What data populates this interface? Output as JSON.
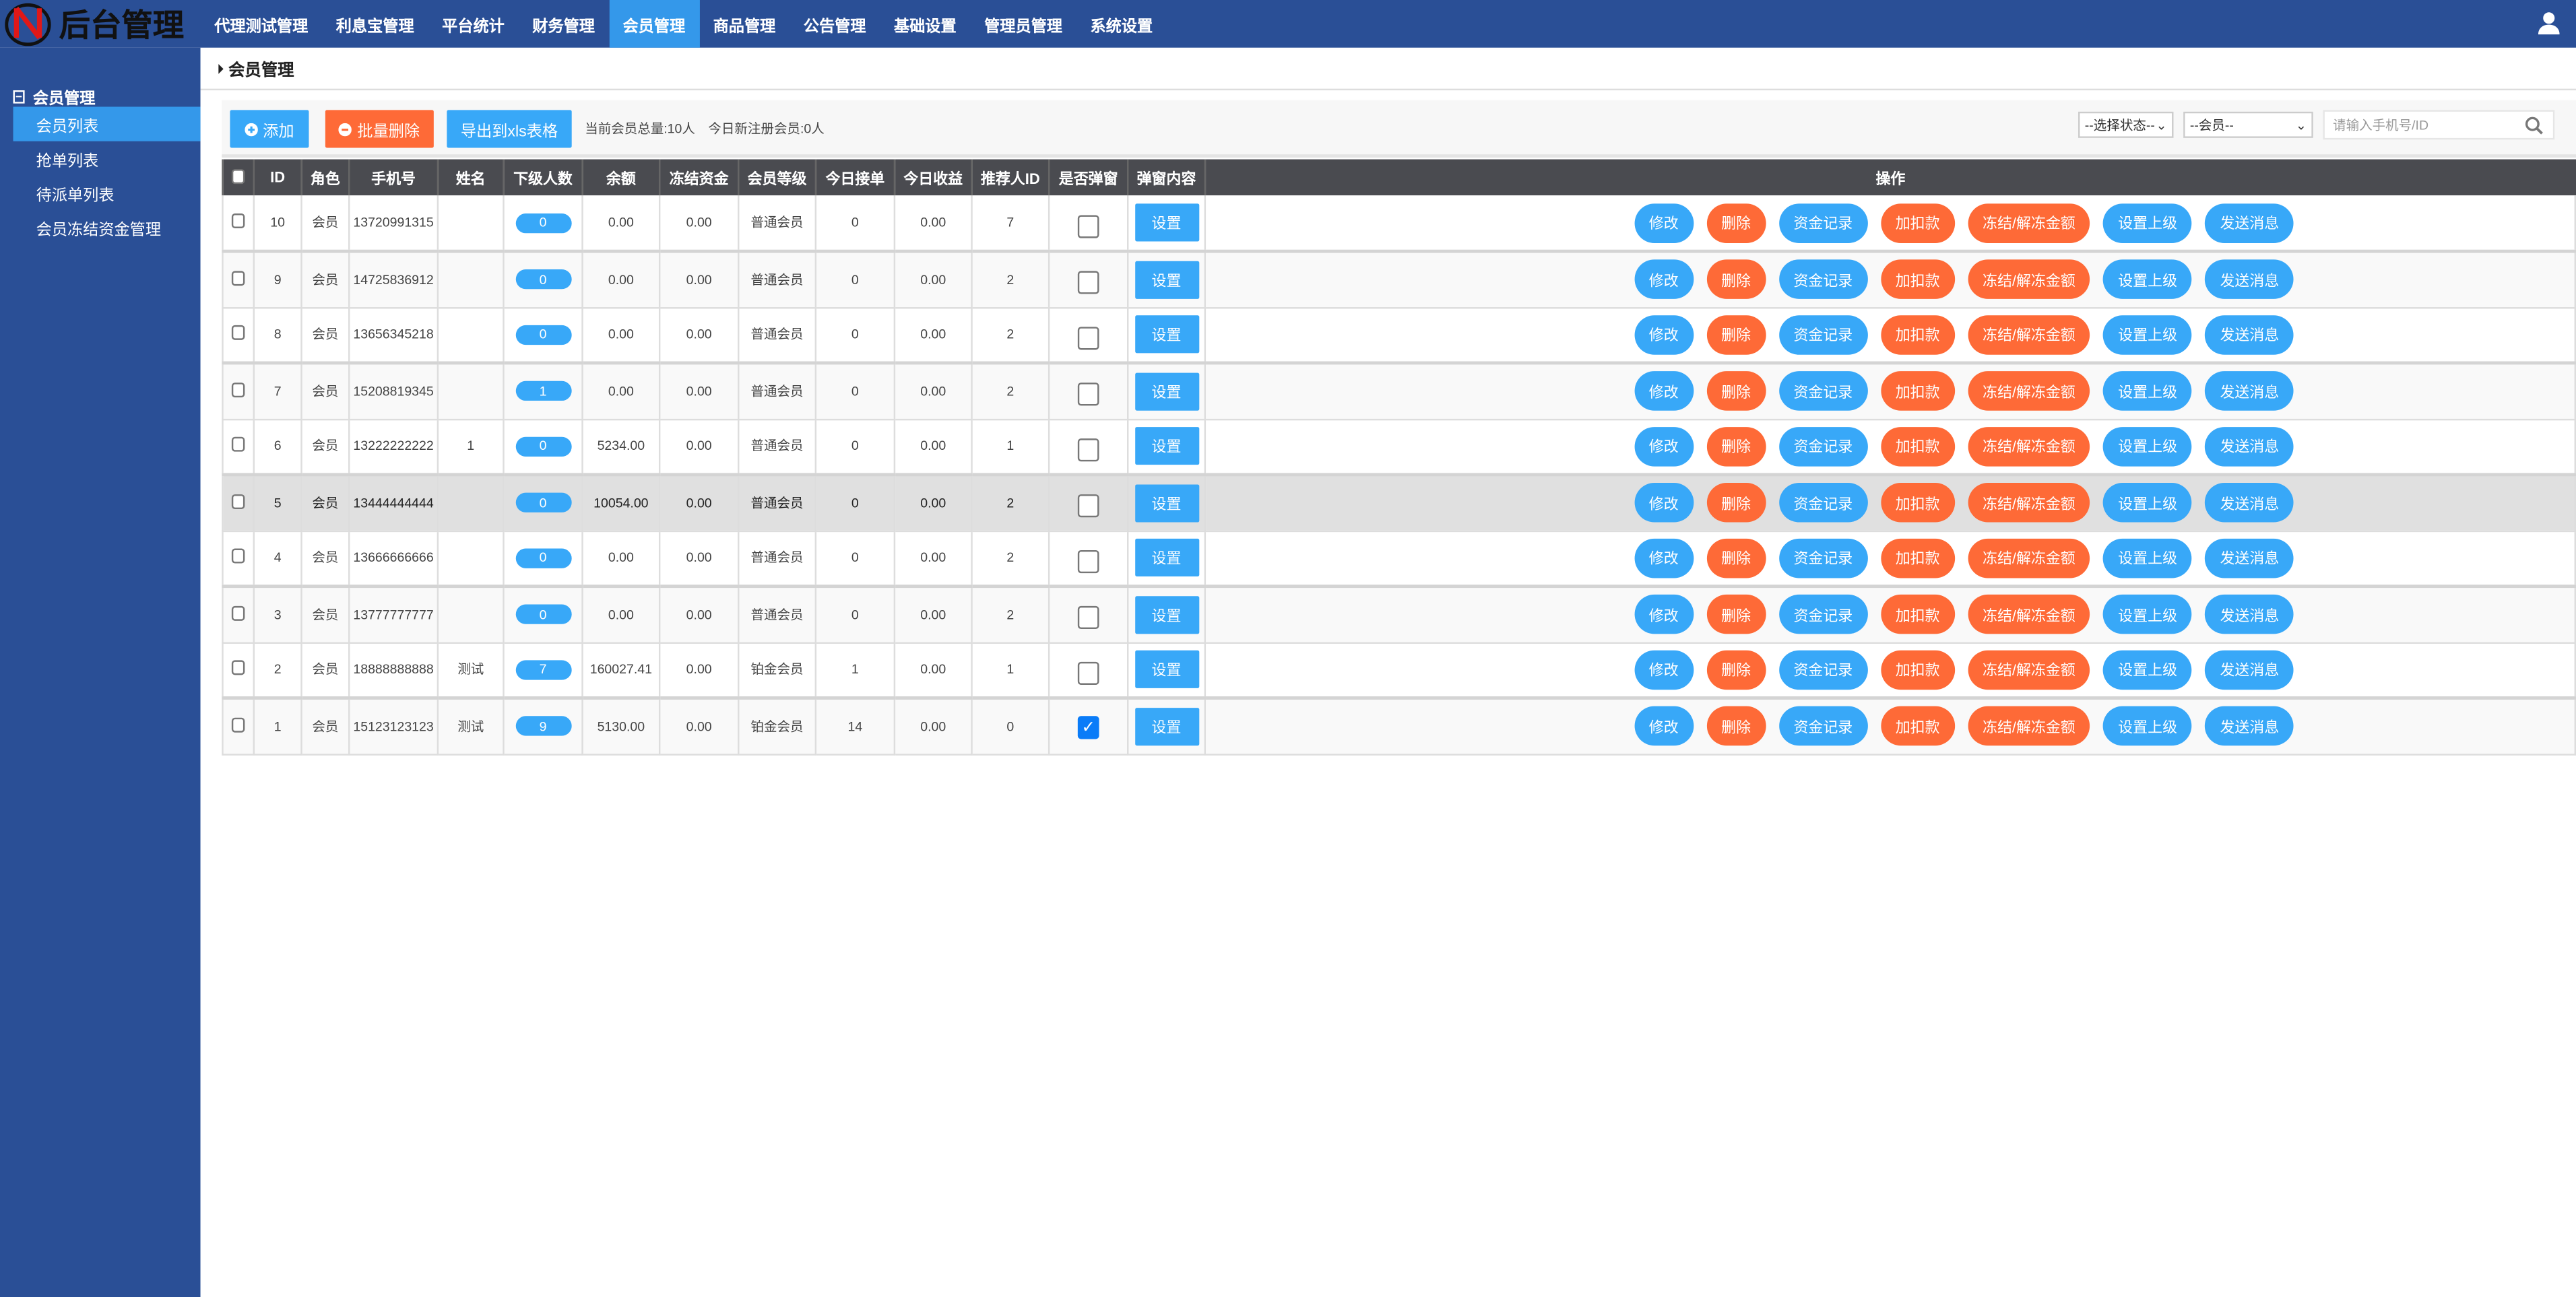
{
  "app": {
    "title": "后台管理"
  },
  "nav": {
    "items": [
      "代理测试管理",
      "利息宝管理",
      "平台统计",
      "财务管理",
      "会员管理",
      "商品管理",
      "公告管理",
      "基础设置",
      "管理员管理",
      "系统设置"
    ],
    "active": 4
  },
  "sidebar": {
    "group": "会员管理",
    "items": [
      "会员列表",
      "抢单列表",
      "待派单列表",
      "会员冻结资金管理"
    ],
    "active": 0
  },
  "breadcrumb": "会员管理",
  "toolbar": {
    "add": "添加",
    "batch_delete": "批量删除",
    "export": "导出到xls表格",
    "stats": "当前会员总量:10人　今日新注册会员:0人",
    "status_select": "--选择状态--",
    "role_select": "--会员--",
    "search_placeholder": "请输入手机号/ID"
  },
  "colors": {
    "nav": "#2a4f96",
    "active": "#3498ea",
    "blue_btn": "#38a8f8",
    "orange_btn": "#fe6a37",
    "table_header": "#4a4b50"
  },
  "table": {
    "headers": [
      "",
      "ID",
      "角色",
      "手机号",
      "姓名",
      "下级人数",
      "余额",
      "冻结资金",
      "会员等级",
      "今日接单",
      "今日收益",
      "推荐人ID",
      "是否弹窗",
      "弹窗内容",
      "操作"
    ],
    "set_label": "设置",
    "actions": [
      {
        "label": "修改",
        "color": "blue"
      },
      {
        "label": "删除",
        "color": "orange"
      },
      {
        "label": "资金记录",
        "color": "blue"
      },
      {
        "label": "加扣款",
        "color": "orange"
      },
      {
        "label": "冻结/解冻金额",
        "color": "orange"
      },
      {
        "label": "设置上级",
        "color": "blue"
      },
      {
        "label": "发送消息",
        "color": "blue"
      }
    ],
    "rows": [
      {
        "id": "10",
        "role": "会员",
        "phone": "13720991315",
        "name": "",
        "sub": "0",
        "balance": "0.00",
        "frozen": "0.00",
        "level": "普通会员",
        "orders": "0",
        "income": "0.00",
        "ref": "7",
        "popup": false
      },
      {
        "id": "9",
        "role": "会员",
        "phone": "14725836912",
        "name": "",
        "sub": "0",
        "balance": "0.00",
        "frozen": "0.00",
        "level": "普通会员",
        "orders": "0",
        "income": "0.00",
        "ref": "2",
        "popup": false
      },
      {
        "id": "8",
        "role": "会员",
        "phone": "13656345218",
        "name": "",
        "sub": "0",
        "balance": "0.00",
        "frozen": "0.00",
        "level": "普通会员",
        "orders": "0",
        "income": "0.00",
        "ref": "2",
        "popup": false
      },
      {
        "id": "7",
        "role": "会员",
        "phone": "15208819345",
        "name": "",
        "sub": "1",
        "balance": "0.00",
        "frozen": "0.00",
        "level": "普通会员",
        "orders": "0",
        "income": "0.00",
        "ref": "2",
        "popup": false
      },
      {
        "id": "6",
        "role": "会员",
        "phone": "13222222222",
        "name": "1",
        "sub": "0",
        "balance": "5234.00",
        "frozen": "0.00",
        "level": "普通会员",
        "orders": "0",
        "income": "0.00",
        "ref": "1",
        "popup": false
      },
      {
        "id": "5",
        "role": "会员",
        "phone": "13444444444",
        "name": "",
        "sub": "0",
        "balance": "10054.00",
        "frozen": "0.00",
        "level": "普通会员",
        "orders": "0",
        "income": "0.00",
        "ref": "2",
        "popup": false,
        "highlighted": true
      },
      {
        "id": "4",
        "role": "会员",
        "phone": "13666666666",
        "name": "",
        "sub": "0",
        "balance": "0.00",
        "frozen": "0.00",
        "level": "普通会员",
        "orders": "0",
        "income": "0.00",
        "ref": "2",
        "popup": false
      },
      {
        "id": "3",
        "role": "会员",
        "phone": "13777777777",
        "name": "",
        "sub": "0",
        "balance": "0.00",
        "frozen": "0.00",
        "level": "普通会员",
        "orders": "0",
        "income": "0.00",
        "ref": "2",
        "popup": false
      },
      {
        "id": "2",
        "role": "会员",
        "phone": "18888888888",
        "name": "测试",
        "sub": "7",
        "balance": "160027.41",
        "frozen": "0.00",
        "level": "铂金会员",
        "orders": "1",
        "income": "0.00",
        "ref": "1",
        "popup": false
      },
      {
        "id": "1",
        "role": "会员",
        "phone": "15123123123",
        "name": "测试",
        "sub": "9",
        "balance": "5130.00",
        "frozen": "0.00",
        "level": "铂金会员",
        "orders": "14",
        "income": "0.00",
        "ref": "0",
        "popup": true
      }
    ]
  }
}
